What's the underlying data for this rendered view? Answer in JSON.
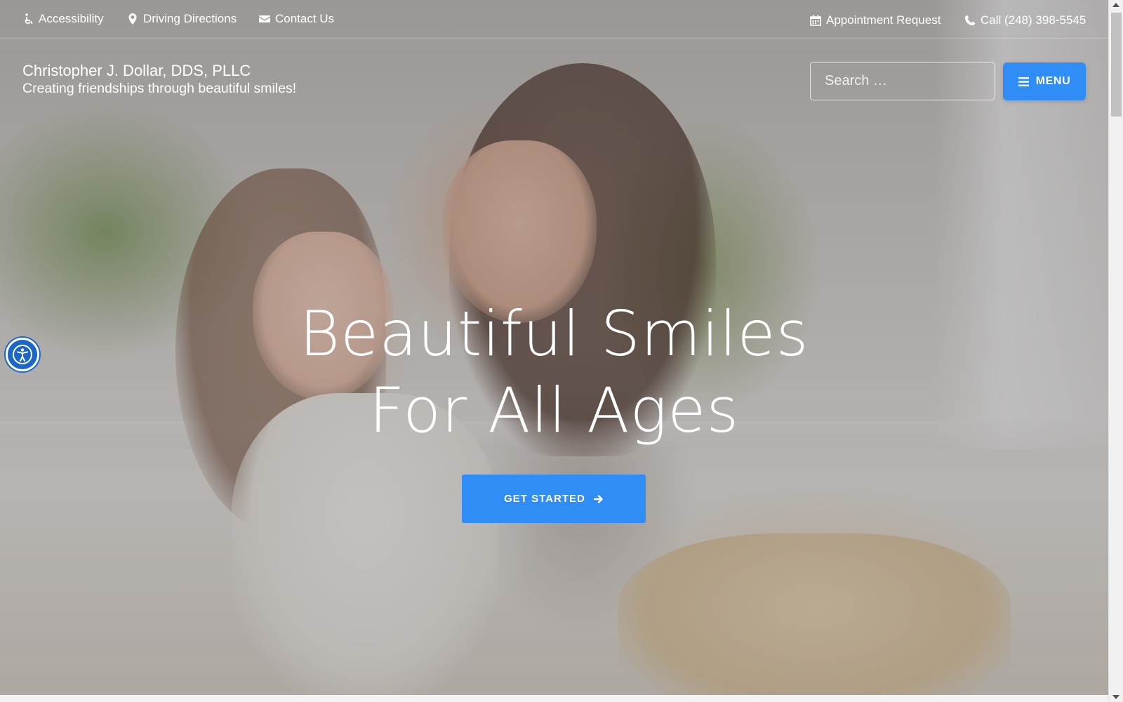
{
  "topbar": {
    "left_links": [
      {
        "label": "Accessibility",
        "icon": "wheelchair-icon"
      },
      {
        "label": "Driving Directions",
        "icon": "map-marker-icon"
      },
      {
        "label": "Contact Us",
        "icon": "envelope-icon"
      }
    ],
    "right_links": [
      {
        "label": "Appointment Request",
        "icon": "calendar-icon"
      },
      {
        "label": "Call (248) 398-5545",
        "icon": "phone-icon"
      }
    ]
  },
  "brand": {
    "name": "Christopher J. Dollar, DDS, PLLC",
    "tagline": "Creating friendships through beautiful smiles!"
  },
  "search": {
    "placeholder": "Search …",
    "button_icon": "search-icon"
  },
  "menu": {
    "label": "MENU",
    "icon": "hamburger-icon"
  },
  "hero": {
    "title_line1": "Beautiful Smiles",
    "title_line2": "For All Ages",
    "cta_label": "GET STARTED",
    "cta_icon": "arrow-right-icon"
  },
  "accessibility_widget": {
    "icon": "accessibility-person-icon"
  },
  "colors": {
    "accent": "#2f8df5",
    "access_widget": "#1a66c9",
    "text": "#ffffff"
  }
}
